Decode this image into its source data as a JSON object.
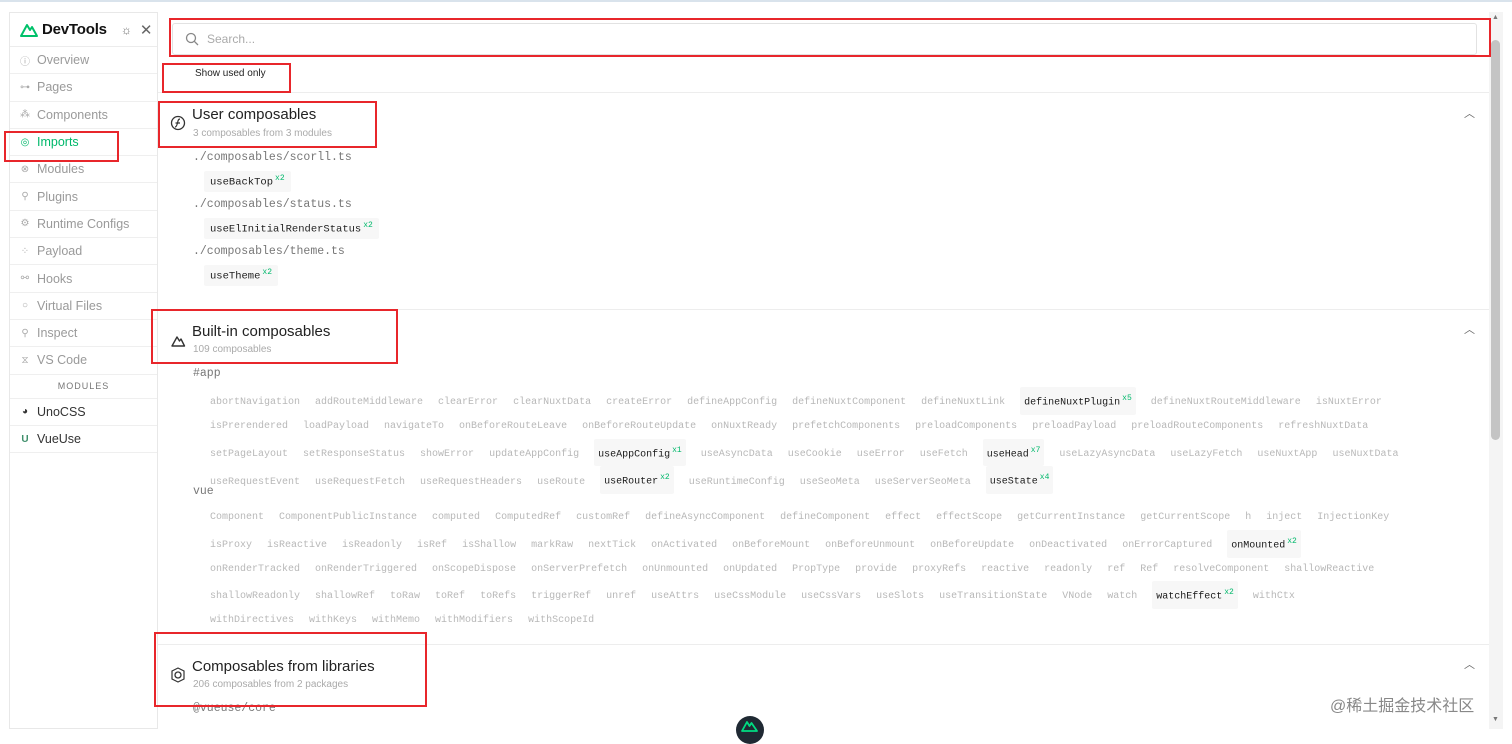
{
  "sidebar": {
    "brand": "DevTools",
    "items": [
      {
        "label": "Overview",
        "icon": "info-icon"
      },
      {
        "label": "Pages",
        "icon": "pages-tree-icon"
      },
      {
        "label": "Components",
        "icon": "components-icon"
      },
      {
        "label": "Imports",
        "icon": "imports-icon"
      },
      {
        "label": "Modules",
        "icon": "modules-icon"
      },
      {
        "label": "Plugins",
        "icon": "plug-icon"
      },
      {
        "label": "Runtime Configs",
        "icon": "gear-icon"
      },
      {
        "label": "Payload",
        "icon": "payload-icon"
      },
      {
        "label": "Hooks",
        "icon": "hooks-icon"
      },
      {
        "label": "Virtual Files",
        "icon": "circle-icon"
      },
      {
        "label": "Inspect",
        "icon": "search-icon"
      },
      {
        "label": "VS Code",
        "icon": "vscode-icon"
      }
    ],
    "modules_label": "MODULES",
    "module_items": [
      {
        "label": "UnoCSS",
        "icon": "unocss-icon"
      },
      {
        "label": "VueUse",
        "icon": "vueuse-icon"
      }
    ]
  },
  "search": {
    "placeholder": "Search..."
  },
  "show_used_only": "Show used only",
  "user_composables": {
    "title": "User composables",
    "subtitle": "3 composables from 3 modules",
    "files": [
      {
        "path": "./composables/scorll.ts",
        "items": [
          {
            "name": "useBackTop",
            "count": "x2"
          }
        ]
      },
      {
        "path": "./composables/status.ts",
        "items": [
          {
            "name": "useElInitialRenderStatus",
            "count": "x2"
          }
        ]
      },
      {
        "path": "./composables/theme.ts",
        "items": [
          {
            "name": "useTheme",
            "count": "x2"
          }
        ]
      }
    ]
  },
  "builtin": {
    "title": "Built-in composables",
    "subtitle": "109 composables",
    "app_label": "#app",
    "vue_label": "vue"
  },
  "libraries": {
    "title": "Composables from libraries",
    "subtitle": "206 composables from 2 packages",
    "first_package": "@vueuse/core"
  },
  "watermark": "@稀土掘金技术社区",
  "app_rows": [
    [
      [
        "abortNavigation",
        ""
      ],
      [
        "addRouteMiddleware",
        ""
      ],
      [
        "clearError",
        ""
      ],
      [
        "clearNuxtData",
        ""
      ],
      [
        "createError",
        ""
      ],
      [
        "defineAppConfig",
        ""
      ],
      [
        "defineNuxtComponent",
        ""
      ],
      [
        "defineNuxtLink",
        ""
      ],
      [
        "defineNuxtPlugin",
        "x5"
      ],
      [
        "defineNuxtRouteMiddleware",
        ""
      ],
      [
        "isNuxtError",
        ""
      ]
    ],
    [
      [
        "isPrerendered",
        ""
      ],
      [
        "loadPayload",
        ""
      ],
      [
        "navigateTo",
        ""
      ],
      [
        "onBeforeRouteLeave",
        ""
      ],
      [
        "onBeforeRouteUpdate",
        ""
      ],
      [
        "onNuxtReady",
        ""
      ],
      [
        "prefetchComponents",
        ""
      ],
      [
        "preloadComponents",
        ""
      ],
      [
        "preloadPayload",
        ""
      ],
      [
        "preloadRouteComponents",
        ""
      ],
      [
        "refreshNuxtData",
        ""
      ]
    ],
    [
      [
        "setPageLayout",
        ""
      ],
      [
        "setResponseStatus",
        ""
      ],
      [
        "showError",
        ""
      ],
      [
        "updateAppConfig",
        ""
      ],
      [
        "useAppConfig",
        "x1"
      ],
      [
        "useAsyncData",
        ""
      ],
      [
        "useCookie",
        ""
      ],
      [
        "useError",
        ""
      ],
      [
        "useFetch",
        ""
      ],
      [
        "useHead",
        "x7"
      ],
      [
        "useLazyAsyncData",
        ""
      ],
      [
        "useLazyFetch",
        ""
      ],
      [
        "useNuxtApp",
        ""
      ],
      [
        "useNuxtData",
        ""
      ]
    ],
    [
      [
        "useRequestEvent",
        ""
      ],
      [
        "useRequestFetch",
        ""
      ],
      [
        "useRequestHeaders",
        ""
      ],
      [
        "useRoute",
        ""
      ],
      [
        "useRouter",
        "x2"
      ],
      [
        "useRuntimeConfig",
        ""
      ],
      [
        "useSeoMeta",
        ""
      ],
      [
        "useServerSeoMeta",
        ""
      ],
      [
        "useState",
        "x4"
      ]
    ]
  ],
  "vue_rows": [
    [
      [
        "Component",
        ""
      ],
      [
        "ComponentPublicInstance",
        ""
      ],
      [
        "computed",
        ""
      ],
      [
        "ComputedRef",
        ""
      ],
      [
        "customRef",
        ""
      ],
      [
        "defineAsyncComponent",
        ""
      ],
      [
        "defineComponent",
        ""
      ],
      [
        "effect",
        ""
      ],
      [
        "effectScope",
        ""
      ],
      [
        "getCurrentInstance",
        ""
      ],
      [
        "getCurrentScope",
        ""
      ],
      [
        "h",
        ""
      ],
      [
        "inject",
        ""
      ],
      [
        "InjectionKey",
        ""
      ]
    ],
    [
      [
        "isProxy",
        ""
      ],
      [
        "isReactive",
        ""
      ],
      [
        "isReadonly",
        ""
      ],
      [
        "isRef",
        ""
      ],
      [
        "isShallow",
        ""
      ],
      [
        "markRaw",
        ""
      ],
      [
        "nextTick",
        ""
      ],
      [
        "onActivated",
        ""
      ],
      [
        "onBeforeMount",
        ""
      ],
      [
        "onBeforeUnmount",
        ""
      ],
      [
        "onBeforeUpdate",
        ""
      ],
      [
        "onDeactivated",
        ""
      ],
      [
        "onErrorCaptured",
        ""
      ],
      [
        "onMounted",
        "x2"
      ]
    ],
    [
      [
        "onRenderTracked",
        ""
      ],
      [
        "onRenderTriggered",
        ""
      ],
      [
        "onScopeDispose",
        ""
      ],
      [
        "onServerPrefetch",
        ""
      ],
      [
        "onUnmounted",
        ""
      ],
      [
        "onUpdated",
        ""
      ],
      [
        "PropType",
        ""
      ],
      [
        "provide",
        ""
      ],
      [
        "proxyRefs",
        ""
      ],
      [
        "reactive",
        ""
      ],
      [
        "readonly",
        ""
      ],
      [
        "ref",
        ""
      ],
      [
        "Ref",
        ""
      ],
      [
        "resolveComponent",
        ""
      ],
      [
        "shallowReactive",
        ""
      ]
    ],
    [
      [
        "shallowReadonly",
        ""
      ],
      [
        "shallowRef",
        ""
      ],
      [
        "toRaw",
        ""
      ],
      [
        "toRef",
        ""
      ],
      [
        "toRefs",
        ""
      ],
      [
        "triggerRef",
        ""
      ],
      [
        "unref",
        ""
      ],
      [
        "useAttrs",
        ""
      ],
      [
        "useCssModule",
        ""
      ],
      [
        "useCssVars",
        ""
      ],
      [
        "useSlots",
        ""
      ],
      [
        "useTransitionState",
        ""
      ],
      [
        "VNode",
        ""
      ],
      [
        "watch",
        ""
      ],
      [
        "watchEffect",
        "x2"
      ],
      [
        "withCtx",
        ""
      ]
    ],
    [
      [
        "withDirectives",
        ""
      ],
      [
        "withKeys",
        ""
      ],
      [
        "withMemo",
        ""
      ],
      [
        "withModifiers",
        ""
      ],
      [
        "withScopeId",
        ""
      ]
    ]
  ]
}
